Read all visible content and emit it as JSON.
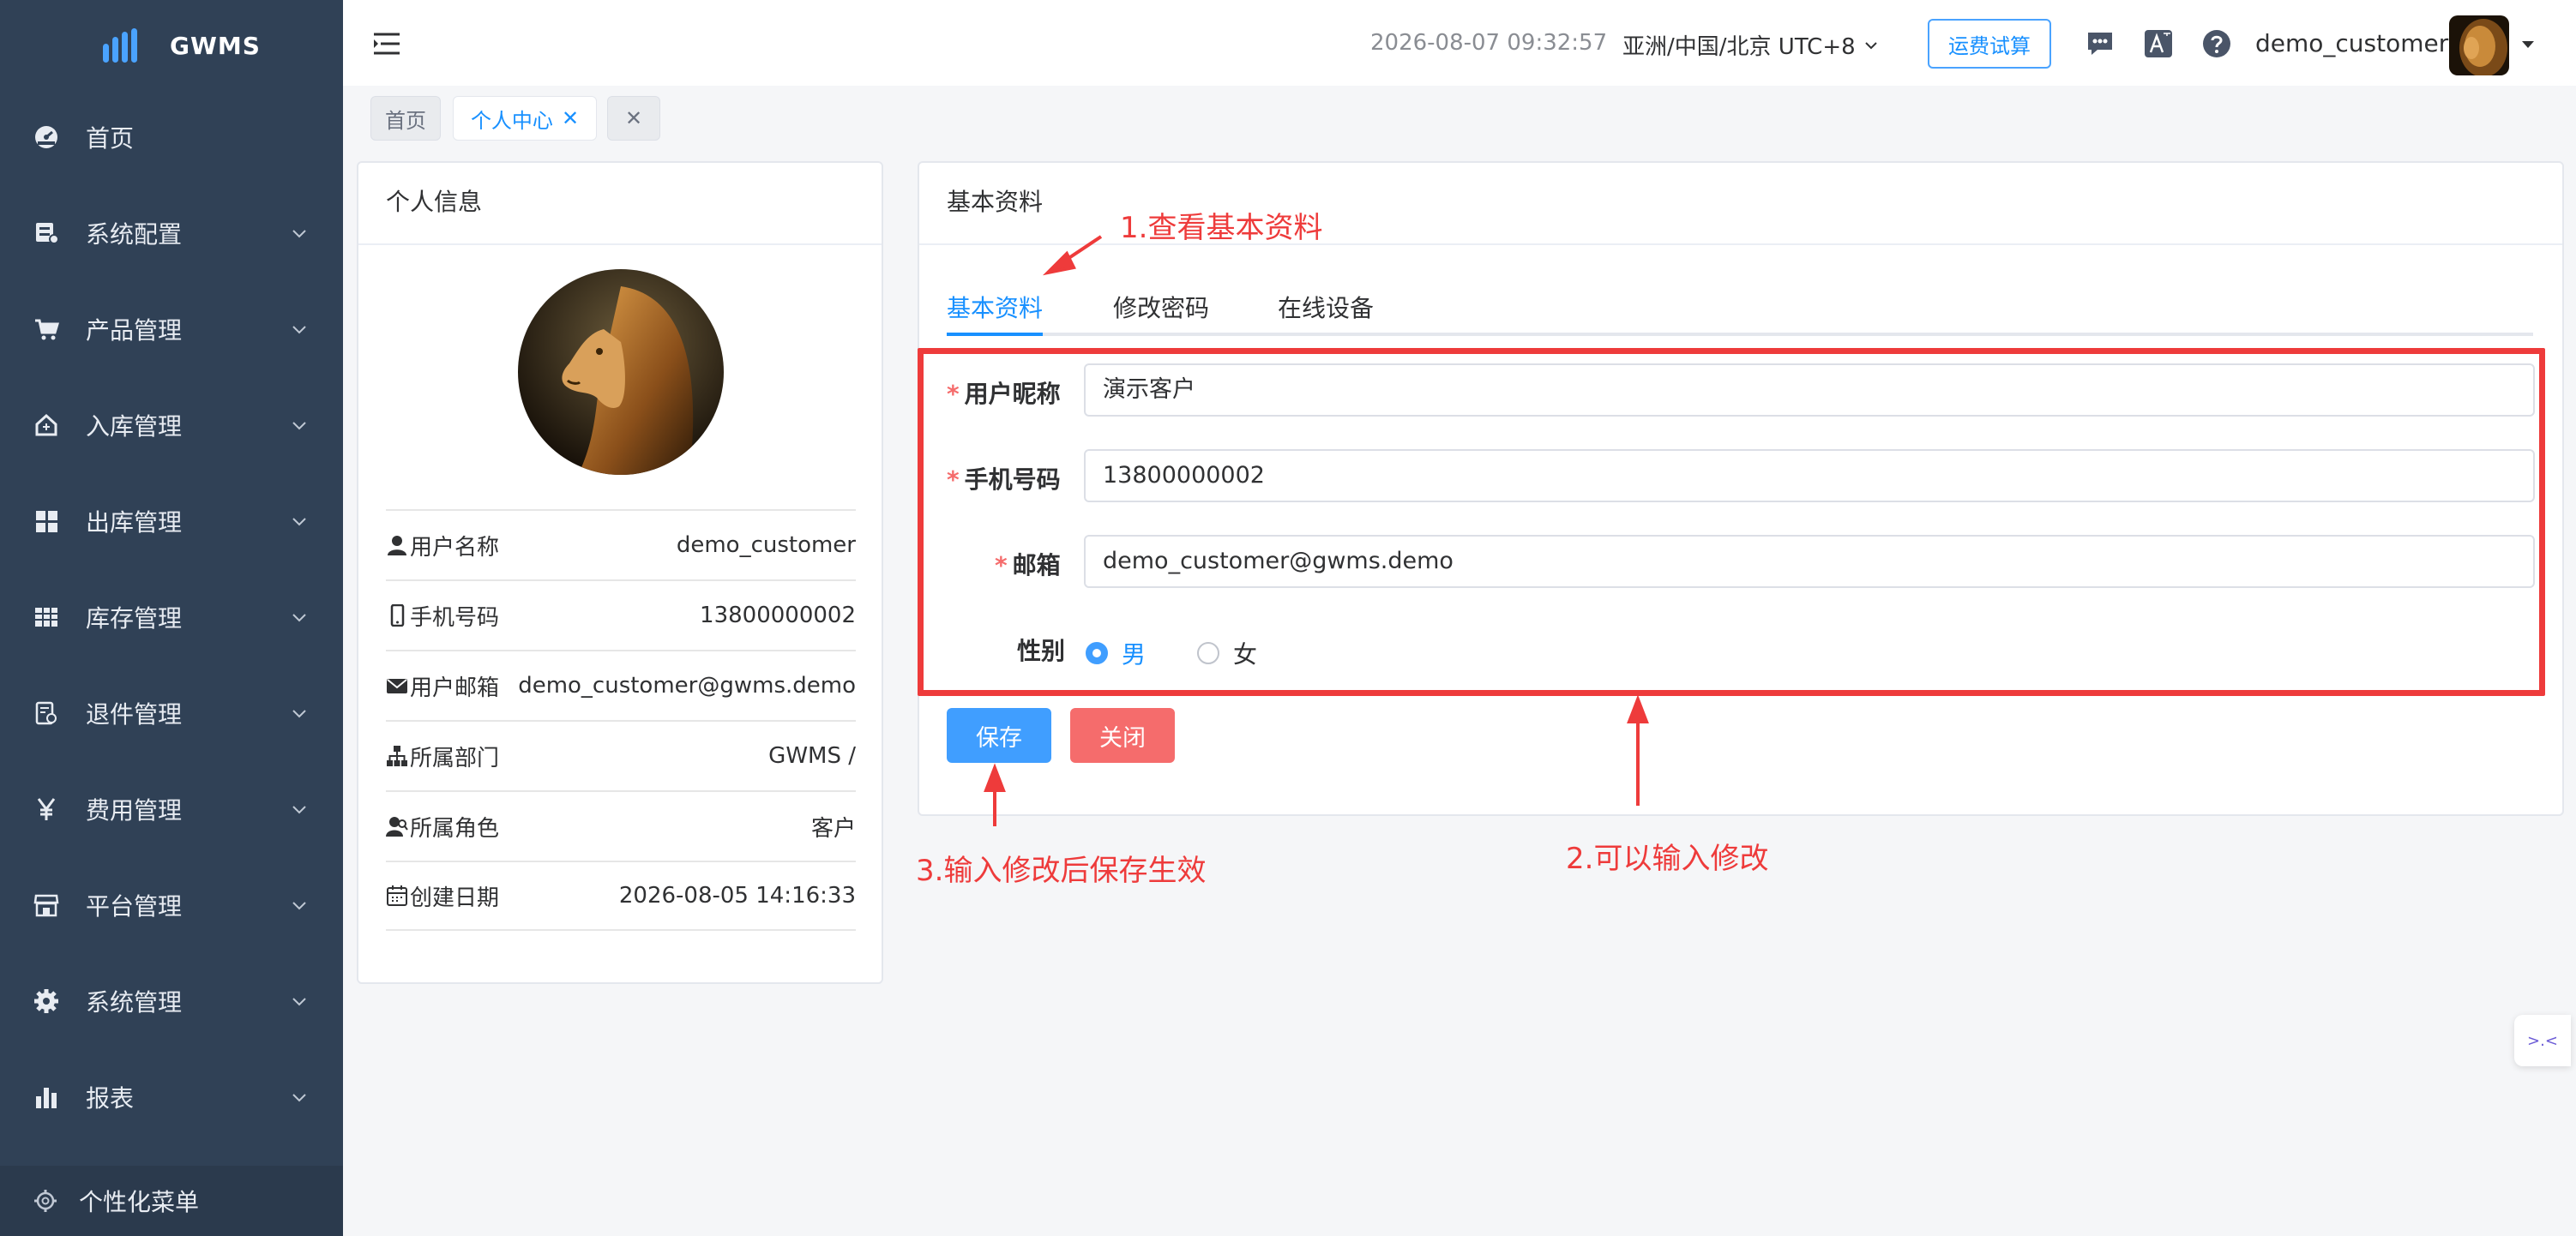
{
  "app": {
    "logo_text": "GWMS",
    "brand_color": "#4aa3ff"
  },
  "sidebar": {
    "items": [
      {
        "label": "首页",
        "icon": "dashboard-icon",
        "expandable": false
      },
      {
        "label": "系统配置",
        "icon": "server-icon",
        "expandable": true
      },
      {
        "label": "产品管理",
        "icon": "cart-icon",
        "expandable": true
      },
      {
        "label": "入库管理",
        "icon": "home-import-icon",
        "expandable": true
      },
      {
        "label": "出库管理",
        "icon": "grid-icon",
        "expandable": true
      },
      {
        "label": "库存管理",
        "icon": "table-icon",
        "expandable": true
      },
      {
        "label": "退件管理",
        "icon": "return-doc-icon",
        "expandable": true
      },
      {
        "label": "费用管理",
        "icon": "yen-icon",
        "expandable": true
      },
      {
        "label": "平台管理",
        "icon": "shop-icon",
        "expandable": true
      },
      {
        "label": "系统管理",
        "icon": "gear-icon",
        "expandable": true
      },
      {
        "label": "报表",
        "icon": "bar-chart-icon",
        "expandable": true
      }
    ],
    "bottom": {
      "label": "个性化菜单",
      "icon": "settings-icon"
    }
  },
  "header": {
    "datetime": "2026-08-07 09:32:57",
    "timezone": "亚洲/中国/北京 UTC+8",
    "calc_button": "运费试算",
    "username": "demo_customer"
  },
  "tags": {
    "home": "首页",
    "active": "个人中心"
  },
  "profile_card": {
    "title": "个人信息",
    "rows": [
      {
        "label": "用户名称",
        "value": "demo_customer",
        "icon": "user-icon"
      },
      {
        "label": "手机号码",
        "value": "13800000002",
        "icon": "phone-icon"
      },
      {
        "label": "用户邮箱",
        "value": "demo_customer@gwms.demo",
        "icon": "mail-icon"
      },
      {
        "label": "所属部门",
        "value": "GWMS /",
        "icon": "org-tree-icon"
      },
      {
        "label": "所属角色",
        "value": "客户",
        "icon": "role-icon"
      },
      {
        "label": "创建日期",
        "value": "2026-08-05 14:16:33",
        "icon": "calendar-icon"
      }
    ]
  },
  "basic_card": {
    "title": "基本资料",
    "tabs": [
      "基本资料",
      "修改密码",
      "在线设备"
    ],
    "active_tab": 0,
    "form": {
      "nickname_label": "用户昵称",
      "nickname_value": "演示客户",
      "phone_label": "手机号码",
      "phone_value": "13800000002",
      "email_label": "邮箱",
      "email_value": "demo_customer@gwms.demo",
      "gender_label": "性别",
      "gender_options": [
        "男",
        "女"
      ],
      "gender_selected": "男"
    },
    "save_button": "保存",
    "close_button": "关闭"
  },
  "annotations": {
    "note1": "1.查看基本资料",
    "note2": "2.可以输入修改",
    "note3": "3.输入修改后保存生效",
    "color": "#ee3b3b"
  },
  "colors": {
    "primary": "#409eff",
    "danger": "#f56c6c",
    "sidebar_bg": "#304156"
  }
}
